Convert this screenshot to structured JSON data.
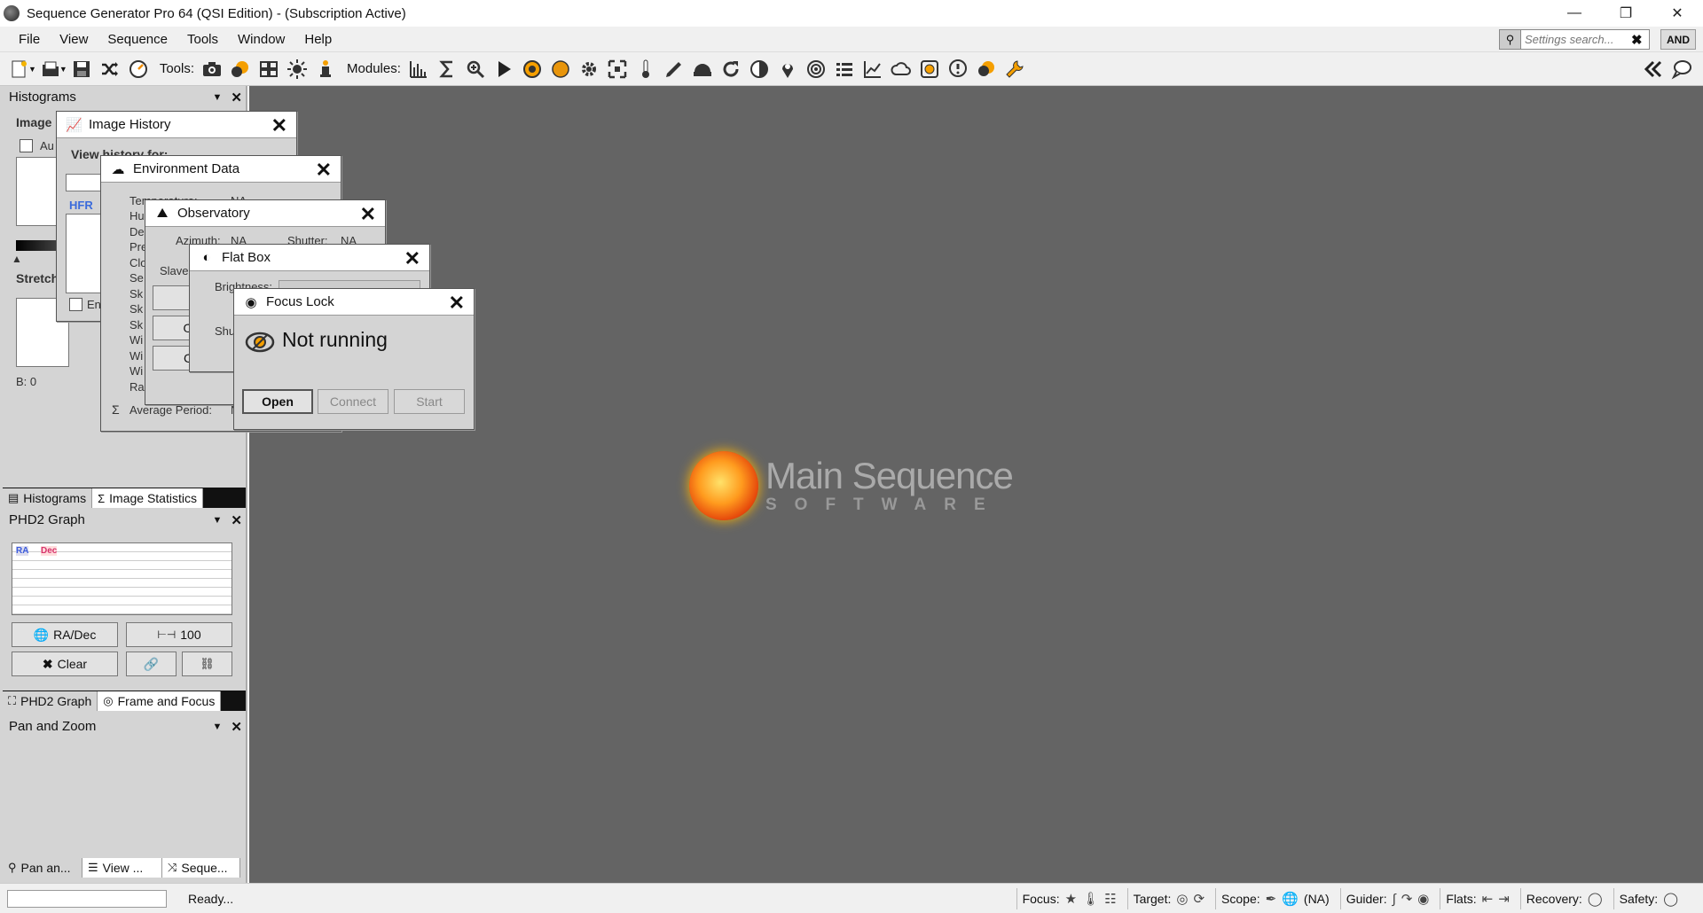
{
  "window": {
    "title": "Sequence Generator Pro 64 (QSI Edition) - (Subscription Active)"
  },
  "menu": [
    "File",
    "View",
    "Sequence",
    "Tools",
    "Window",
    "Help"
  ],
  "search": {
    "placeholder": "Settings search...",
    "and_label": "AND"
  },
  "toolbar": {
    "tools_label": "Tools:",
    "modules_label": "Modules:",
    "file_icons": [
      "new-sequence-icon",
      "open-icon",
      "save-icon",
      "shuffle-icon",
      "gauge-icon"
    ],
    "tool_icons": [
      "camera-icon",
      "multi-star-icon",
      "grid-icon",
      "sun-icon",
      "dropper-icon"
    ],
    "module_icons": [
      "histogram-icon",
      "sigma-icon",
      "magnify-icon",
      "play-icon",
      "target-icon",
      "circle-icon",
      "gear-icon",
      "expand-icon",
      "thermometer-icon",
      "pen-icon",
      "dome-icon",
      "refresh-icon",
      "contrast-icon",
      "pin-icon",
      "focus-icon",
      "list-icon",
      "chart-icon",
      "cloud-icon",
      "lock-icon",
      "alert-icon",
      "ball-icon",
      "wrench-icon"
    ]
  },
  "panels": {
    "histograms": {
      "title": "Histograms",
      "image_label": "Image",
      "auto_label": "Au",
      "stretch_label": "Stretch",
      "en_label": "En",
      "b_value": "B: 0",
      "tabs": [
        "Histograms",
        "Image Statistics"
      ]
    },
    "phd2": {
      "title": "PHD2 Graph",
      "legend_ra": "RA",
      "legend_dec": "Dec",
      "btn_radec": "RA/Dec",
      "btn_scale": "100",
      "btn_clear": "Clear",
      "tabs": [
        "PHD2 Graph",
        "Frame and Focus"
      ]
    },
    "panzoom": {
      "title": "Pan and Zoom",
      "tabs": [
        "Pan an...",
        "View ...",
        "Seque..."
      ]
    }
  },
  "dialogs": {
    "image_history": {
      "title": "Image History",
      "view_history_label": "View history for:",
      "hfr_label": "HFR"
    },
    "environment": {
      "title": "Environment Data",
      "rows": [
        "Temperature:",
        "Hu",
        "De",
        "Pre",
        "Clo",
        "Se",
        "Sk",
        "Sk",
        "Sk",
        "Wi",
        "Wi",
        "Wi",
        "Rain Rate:",
        "Average Period:"
      ],
      "temp_value": "NA",
      "avg_value": "N"
    },
    "observatory": {
      "title": "Observatory",
      "azimuth_label": "Azimuth:",
      "azimuth_value": "NA",
      "shutter_label": "Shutter:",
      "shutter_value": "NA",
      "slave_label": "Slave",
      "btn2": "O",
      "btn3": "C"
    },
    "flatbox": {
      "title": "Flat Box",
      "brightness_label": "Brightness:",
      "shutter_label": "Shu"
    },
    "focuslock": {
      "title": "Focus Lock",
      "status": "Not running",
      "btn_open": "Open",
      "btn_connect": "Connect",
      "btn_start": "Start"
    }
  },
  "logo": {
    "line1": "Main Sequence",
    "line2": "SOFTWARE"
  },
  "status": {
    "ready": "Ready...",
    "focus_label": "Focus:",
    "target_label": "Target:",
    "scope_label": "Scope:",
    "scope_value": "(NA)",
    "guider_label": "Guider:",
    "flats_label": "Flats:",
    "recovery_label": "Recovery:",
    "safety_label": "Safety:"
  },
  "colors": {
    "workspace": "#646464",
    "panel": "#d4d4d4",
    "ra": "#3b5bdb",
    "dec": "#d6336c"
  }
}
